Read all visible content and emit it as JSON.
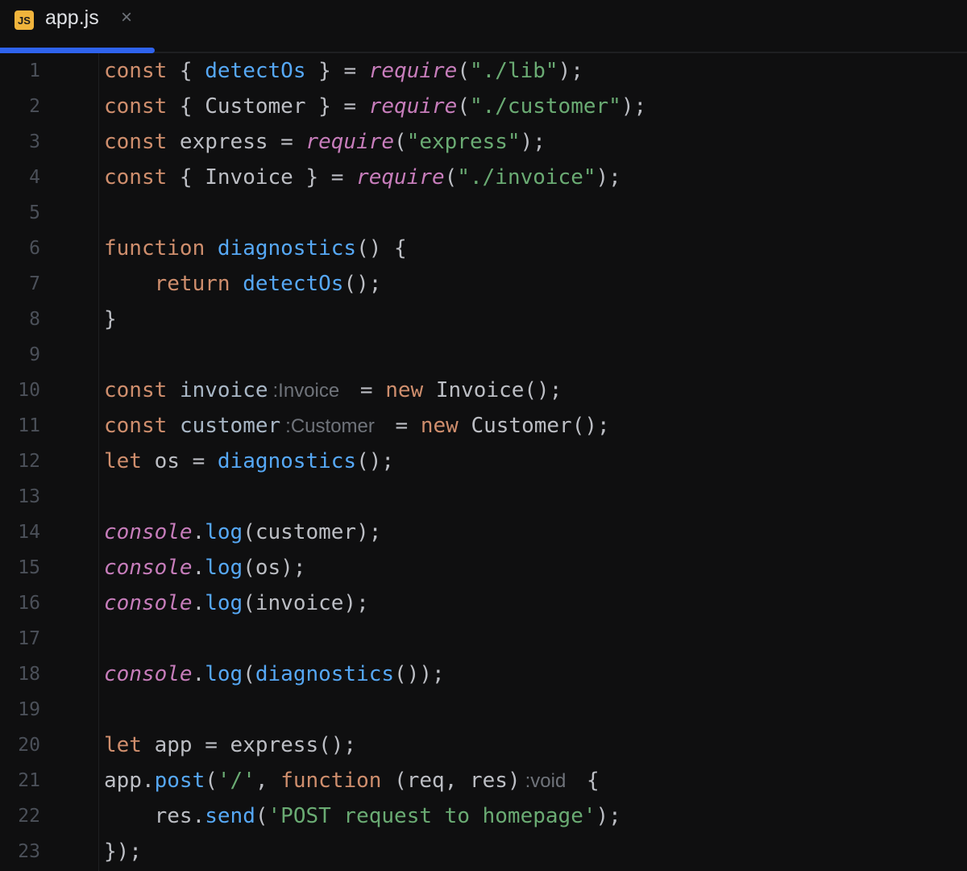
{
  "tab": {
    "icon": "JS",
    "filename": "app.js",
    "close": "×",
    "accent": "#2f63ee"
  },
  "lines": [
    [
      [
        "const",
        "k"
      ],
      [
        " { ",
        "t"
      ],
      [
        "detectOs",
        "f"
      ],
      [
        " } = ",
        "t"
      ],
      [
        "require",
        "i"
      ],
      [
        "(",
        "t"
      ],
      [
        "\"./lib\"",
        "s"
      ],
      [
        ");",
        "t"
      ]
    ],
    [
      [
        "const",
        "k"
      ],
      [
        " { Customer } = ",
        "t"
      ],
      [
        "require",
        "i"
      ],
      [
        "(",
        "t"
      ],
      [
        "\"./customer\"",
        "s"
      ],
      [
        ");",
        "t"
      ]
    ],
    [
      [
        "const",
        "k"
      ],
      [
        " express = ",
        "t"
      ],
      [
        "require",
        "i"
      ],
      [
        "(",
        "t"
      ],
      [
        "\"express\"",
        "s"
      ],
      [
        ");",
        "t"
      ]
    ],
    [
      [
        "const",
        "k"
      ],
      [
        " { Invoice } = ",
        "t"
      ],
      [
        "require",
        "i"
      ],
      [
        "(",
        "t"
      ],
      [
        "\"./invoice\"",
        "s"
      ],
      [
        ");",
        "t"
      ]
    ],
    [],
    [
      [
        "function",
        "k"
      ],
      [
        " ",
        "t"
      ],
      [
        "diagnostics",
        "f"
      ],
      [
        "() {",
        "t"
      ]
    ],
    [
      [
        "    ",
        "t"
      ],
      [
        "return",
        "k"
      ],
      [
        " ",
        "t"
      ],
      [
        "detectOs",
        "f"
      ],
      [
        "();",
        "t"
      ]
    ],
    [
      [
        "}",
        "t"
      ]
    ],
    [],
    [
      [
        "const",
        "k"
      ],
      [
        " ",
        "t"
      ],
      [
        "invoice",
        "v"
      ],
      [
        ":Invoice",
        "h"
      ],
      [
        " = ",
        "t"
      ],
      [
        "new",
        "k"
      ],
      [
        " Invoice();",
        "t"
      ]
    ],
    [
      [
        "const",
        "k"
      ],
      [
        " ",
        "t"
      ],
      [
        "customer",
        "v"
      ],
      [
        ":Customer",
        "h"
      ],
      [
        " = ",
        "t"
      ],
      [
        "new",
        "k"
      ],
      [
        " Customer();",
        "t"
      ]
    ],
    [
      [
        "let",
        "k"
      ],
      [
        " os = ",
        "t"
      ],
      [
        "diagnostics",
        "f"
      ],
      [
        "();",
        "t"
      ]
    ],
    [],
    [
      [
        "console",
        "i"
      ],
      [
        ".",
        "t"
      ],
      [
        "log",
        "f"
      ],
      [
        "(customer);",
        "t"
      ]
    ],
    [
      [
        "console",
        "i"
      ],
      [
        ".",
        "t"
      ],
      [
        "log",
        "f"
      ],
      [
        "(os);",
        "t"
      ]
    ],
    [
      [
        "console",
        "i"
      ],
      [
        ".",
        "t"
      ],
      [
        "log",
        "f"
      ],
      [
        "(invoice);",
        "t"
      ]
    ],
    [],
    [
      [
        "console",
        "i"
      ],
      [
        ".",
        "t"
      ],
      [
        "log",
        "f"
      ],
      [
        "(",
        "t"
      ],
      [
        "diagnostics",
        "f"
      ],
      [
        "());",
        "t"
      ]
    ],
    [],
    [
      [
        "let",
        "k"
      ],
      [
        " app = express();",
        "t"
      ]
    ],
    [
      [
        "app.",
        "t"
      ],
      [
        "post",
        "f"
      ],
      [
        "(",
        "t"
      ],
      [
        "'/'",
        "s"
      ],
      [
        ", ",
        "t"
      ],
      [
        "function",
        "k"
      ],
      [
        " (req, res)",
        "t"
      ],
      [
        ":void",
        "h"
      ],
      [
        " {",
        "t"
      ]
    ],
    [
      [
        "    res.",
        "t"
      ],
      [
        "send",
        "f"
      ],
      [
        "(",
        "t"
      ],
      [
        "'POST request to homepage'",
        "s"
      ],
      [
        ");",
        "t"
      ]
    ],
    [
      [
        "});",
        "t"
      ]
    ]
  ]
}
